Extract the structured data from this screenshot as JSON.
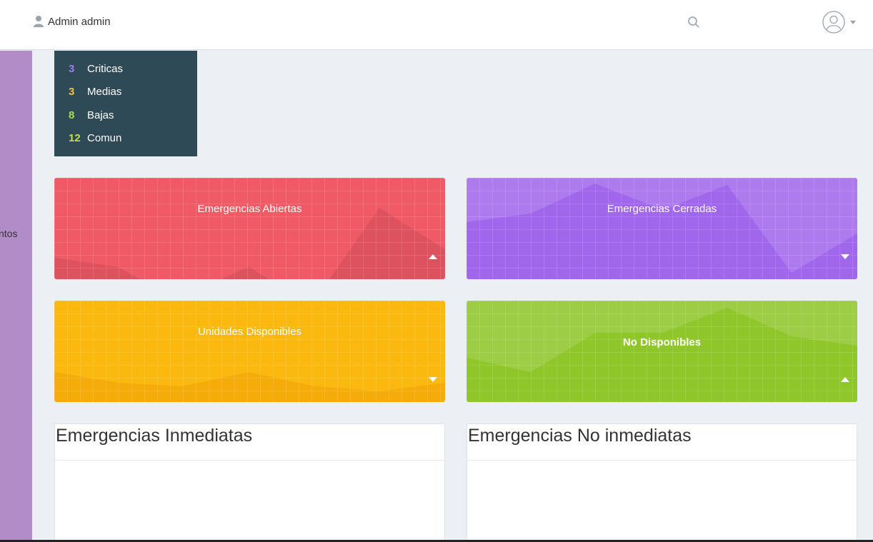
{
  "header": {
    "user_name": "Admin admin",
    "icons": {
      "user": "user-icon",
      "search": "search-icon",
      "avatar": "avatar-icon",
      "menu": "chevron-down-icon"
    }
  },
  "sidebar": {
    "partial_label": "ntos"
  },
  "counts": [
    {
      "value": "3",
      "label": "Criticas",
      "color": "#a07cf0"
    },
    {
      "value": "3",
      "label": "Medias",
      "color": "#f5c33b"
    },
    {
      "value": "8",
      "label": "Bajas",
      "color": "#a6e04a"
    },
    {
      "value": "12",
      "label": "Comun",
      "color": "#c6e04a"
    }
  ],
  "cards": [
    {
      "title": "Emergencias Abiertas",
      "color": "#f05a65",
      "trend": "up"
    },
    {
      "title": "Emergencias Cerradas",
      "color": "#a066ec",
      "trend": "down"
    },
    {
      "title": "Unidades Disponibles",
      "color": "#fbb80f",
      "trend": "down"
    },
    {
      "title": "No Disponibles",
      "color": "#8fc62a",
      "trend": "up"
    }
  ],
  "panels": [
    {
      "title": "Emergencias Inmediatas"
    },
    {
      "title": "Emergencias No inmediatas"
    }
  ]
}
